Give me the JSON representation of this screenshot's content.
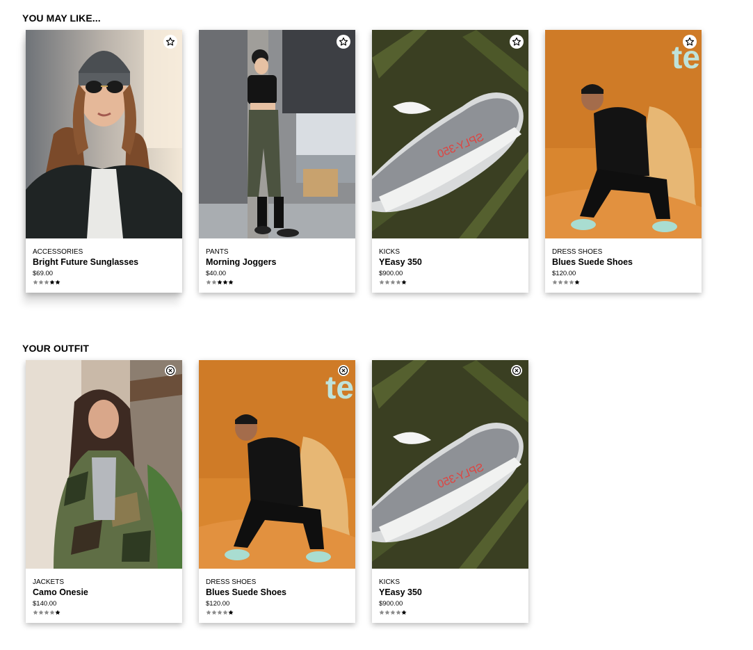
{
  "sections": {
    "like_title": "YOU MAY LIKE...",
    "outfit_title": "YOUR OUTFIT"
  },
  "like_cards": [
    {
      "category": "ACCESSORIES",
      "name": "Bright Future Sunglasses",
      "price": "$69.00",
      "rating": 2,
      "photo": "woman-beanie-sunglasses",
      "action_icon": "star-outline-icon"
    },
    {
      "category": "PANTS",
      "name": "Morning Joggers",
      "price": "$40.00",
      "rating": 3,
      "photo": "woman-cargo-joggers",
      "action_icon": "star-outline-icon"
    },
    {
      "category": "KICKS",
      "name": "YEasy 350",
      "price": "$900.00",
      "rating": 1,
      "photo": "yeezy-sneaker",
      "action_icon": "star-outline-icon"
    },
    {
      "category": "DRESS SHOES",
      "name": "Blues Suede Shoes",
      "price": "$120.00",
      "rating": 1,
      "photo": "man-orange-fur",
      "action_icon": "star-outline-icon"
    }
  ],
  "outfit_cards": [
    {
      "category": "JACKETS",
      "name": "Camo Onesie",
      "price": "$140.00",
      "rating": 1,
      "photo": "woman-camo-jacket",
      "action_icon": "remove-circle-icon"
    },
    {
      "category": "DRESS SHOES",
      "name": "Blues Suede Shoes",
      "price": "$120.00",
      "rating": 1,
      "photo": "man-orange-fur",
      "action_icon": "remove-circle-icon"
    },
    {
      "category": "KICKS",
      "name": "YEasy 350",
      "price": "$900.00",
      "rating": 1,
      "photo": "yeezy-sneaker",
      "action_icon": "remove-circle-icon"
    }
  ],
  "rating_scale": 5,
  "colors": {
    "star_filled": "#000000",
    "star_empty": "#8a8a8a",
    "card_bg": "#ffffff"
  }
}
